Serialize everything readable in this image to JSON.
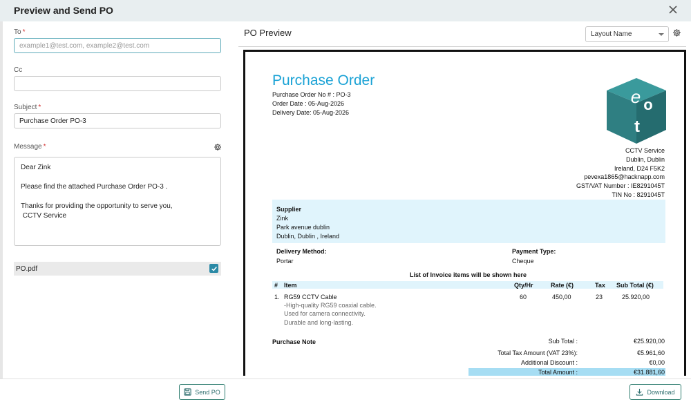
{
  "dialog": {
    "title": "Preview and Send PO"
  },
  "form": {
    "to_label": "To",
    "to_placeholder": "example1@test.com, example2@test.com",
    "cc_label": "Cc",
    "subject_label": "Subject",
    "subject_value": "Purchase Order PO-3",
    "message_label": "Message",
    "message_lines": [
      "Dear  Zink",
      "",
      "Please find the attached Purchase Order  PO-3 .",
      "",
      "Thanks for providing the opportunity to serve you,",
      " CCTV Service"
    ],
    "attachment_name": "PO.pdf",
    "attachment_checked": true
  },
  "preview": {
    "title": "PO Preview",
    "layout_select_value": "Layout Name"
  },
  "po": {
    "doc_title": "Purchase Order",
    "order_no": "Purchase Order No # : PO-3",
    "order_date": "Order Date : 05-Aug-2026",
    "delivery_date": "Delivery Date: 05-Aug-2026",
    "company": [
      "CCTV Service",
      "Dublin, Dublin",
      "Ireland, D24 F5K2",
      "pevexa1865@hacknapp.com",
      "GST/VAT Number : IE8291045T",
      "TIN No : 8291045T"
    ],
    "supplier_label": "Supplier",
    "supplier_lines": [
      "Zink",
      "Park avenue dublin",
      "Dublin, Dublin , Ireland"
    ],
    "delivery_method_label": "Delivery Method:",
    "delivery_method": "Portar",
    "payment_type_label": "Payment Type:",
    "payment_type": "Cheque",
    "items_heading": "List of Invoice items will be shown here",
    "columns": [
      "#",
      "Item",
      "Qty/Hr",
      "Rate (€)",
      "Tax",
      "Sub Total (€)"
    ],
    "items": [
      {
        "no": "1.",
        "name": "RG59 CCTV Cable",
        "desc": [
          "-High-quality RG59 coaxial cable.",
          "Used for camera connectivity.",
          "Durable and long-lasting."
        ],
        "qty": "60",
        "rate": "450,00",
        "tax": "23",
        "subtotal": "25.920,00"
      }
    ],
    "note_label": "Purchase Note",
    "totals": [
      {
        "label": "Sub Total :",
        "value": "€25.920,00"
      },
      {
        "label": "Total Tax Amount (VAT 23%):",
        "value": "€5.961,60"
      },
      {
        "label": "Additional Discount :",
        "value": "€0,00"
      },
      {
        "label": "Total Amount :",
        "value": "€31.881,60"
      }
    ],
    "logo_letters": [
      "e",
      "o",
      "t"
    ]
  },
  "footer": {
    "send_label": "Send PO",
    "download_label": "Download"
  },
  "colors": {
    "accent": "#1aa2d5",
    "teal": "#2b8aa6",
    "band": "#e0f4fc",
    "total_band": "#a6ddf3",
    "logo": "#2f7f82"
  }
}
